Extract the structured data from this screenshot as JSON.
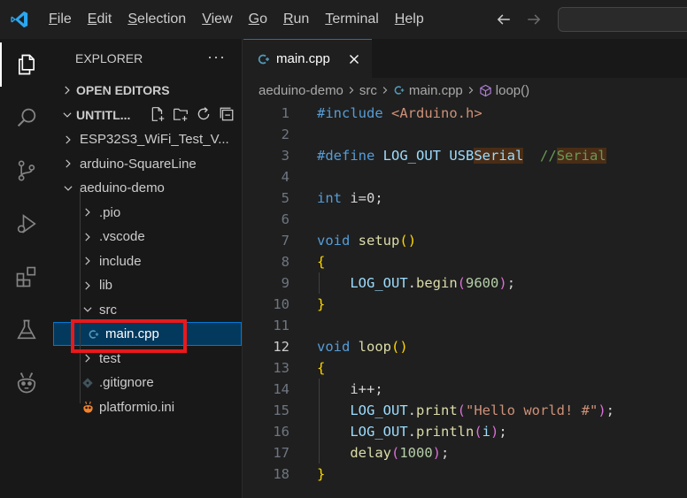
{
  "titlebar": {
    "menu": [
      {
        "accel": "F",
        "rest": "ile"
      },
      {
        "accel": "E",
        "rest": "dit"
      },
      {
        "accel": "S",
        "rest": "election"
      },
      {
        "accel": "V",
        "rest": "iew"
      },
      {
        "accel": "G",
        "rest": "o"
      },
      {
        "accel": "R",
        "rest": "un"
      },
      {
        "accel": "T",
        "rest": "erminal"
      },
      {
        "accel": "H",
        "rest": "elp"
      }
    ]
  },
  "sidebar": {
    "title": "EXPLORER",
    "more": "···",
    "open_editors": "OPEN EDITORS",
    "workspace": "UNTITL...",
    "items": [
      {
        "label": "ESP32S3_WiFi_Test_V...",
        "expanded": false,
        "depth": 1
      },
      {
        "label": "arduino-SquareLine",
        "expanded": false,
        "depth": 1
      },
      {
        "label": "aeduino-demo",
        "expanded": true,
        "depth": 1
      },
      {
        "label": ".pio",
        "expanded": false,
        "depth": 2
      },
      {
        "label": ".vscode",
        "expanded": false,
        "depth": 2
      },
      {
        "label": "include",
        "expanded": false,
        "depth": 2
      },
      {
        "label": "lib",
        "expanded": false,
        "depth": 2
      },
      {
        "label": "src",
        "expanded": true,
        "depth": 2
      },
      {
        "label": "main.cpp",
        "file": "cpp",
        "depth": 3,
        "selected": true
      },
      {
        "label": "test",
        "expanded": false,
        "depth": 2
      },
      {
        "label": ".gitignore",
        "file": "git",
        "depth": 2
      },
      {
        "label": "platformio.ini",
        "file": "pio",
        "depth": 2
      }
    ]
  },
  "editor": {
    "tab": {
      "label": "main.cpp"
    },
    "breadcrumbs": [
      "aeduino-demo",
      "src",
      "main.cpp",
      "loop()"
    ],
    "current_line": 12,
    "lines": [
      "1",
      "2",
      "3",
      "4",
      "5",
      "6",
      "7",
      "8",
      "9",
      "10",
      "11",
      "12",
      "13",
      "14",
      "15",
      "16",
      "17",
      "18"
    ],
    "code": {
      "l1_kw": "#include",
      "l1_inc": "<Arduino.h>",
      "l3_kw": "#define",
      "l3_name": "LOG_OUT",
      "l3_usb": "USB",
      "l3_serial": "Serial",
      "l3_cmt": "//",
      "l3_cmt2": "Serial",
      "l5_kw": "int",
      "l5_rest": " i=0;",
      "l7_kw": "void",
      "l7_fn": "setup",
      "l7_open": "(",
      "l7_close": ")",
      "l8_brace": "{",
      "l9_id": "LOG_OUT",
      "l9_dot": ".",
      "l9_fn": "begin",
      "l9_open": "(",
      "l9_num": "9600",
      "l9_close": ")",
      "l9_semi": ";",
      "l10_brace": "}",
      "l12_kw": "void",
      "l12_fn": "loop",
      "l12_open": "(",
      "l12_close": ")",
      "l13_brace": "{",
      "l14_text": "i++;",
      "l15_id": "LOG_OUT",
      "l15_dot": ".",
      "l15_fn": "print",
      "l15_open": "(",
      "l15_str": "\"Hello world! #\"",
      "l15_close": ")",
      "l15_semi": ";",
      "l16_id": "LOG_OUT",
      "l16_dot": ".",
      "l16_fn": "println",
      "l16_open": "(",
      "l16_arg": "i",
      "l16_close": ")",
      "l16_semi": ";",
      "l17_fn": "delay",
      "l17_open": "(",
      "l17_num": "1000",
      "l17_close": ")",
      "l17_semi": ";",
      "l18_brace": "}"
    }
  },
  "colors": {
    "accent": "#0078d4",
    "annotation_box": "#e8191c",
    "cpp_icon": "#519aba",
    "pio_icon": "#f5822a"
  },
  "icons": [
    "vscode-logo-icon",
    "arrow-left-icon",
    "arrow-right-icon",
    "explorer-icon",
    "search-icon",
    "source-control-icon",
    "run-debug-icon",
    "extensions-icon",
    "testing-icon",
    "platformio-icon",
    "new-file-icon",
    "new-folder-icon",
    "refresh-icon",
    "collapse-all-icon",
    "chevron-right-icon",
    "chevron-down-icon",
    "cpp-file-icon",
    "git-file-icon",
    "platformio-file-icon",
    "close-icon",
    "symbol-method-icon"
  ]
}
